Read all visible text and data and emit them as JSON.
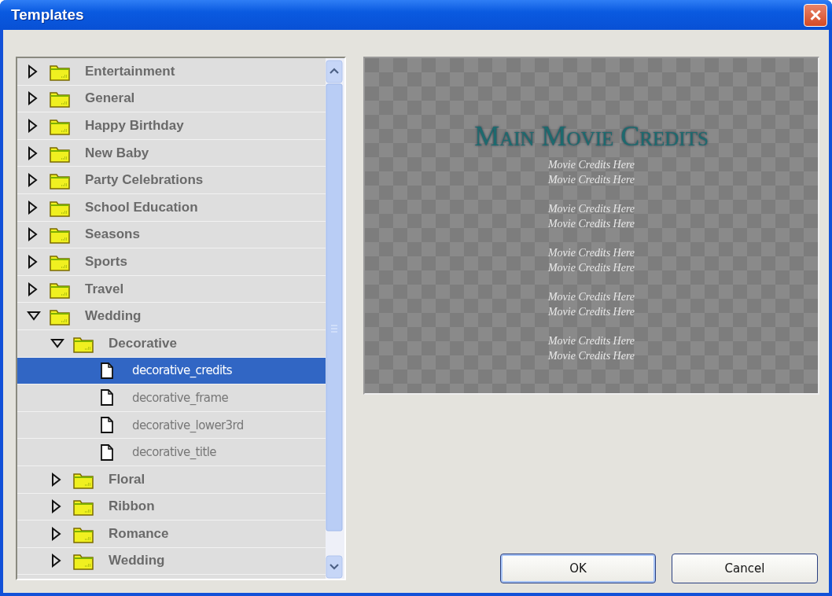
{
  "window": {
    "title": "Templates",
    "close": "×"
  },
  "tree": [
    {
      "kind": "folder",
      "label": "Entertainment",
      "expanded": false,
      "selected": false
    },
    {
      "kind": "folder",
      "label": "General",
      "expanded": false,
      "selected": false
    },
    {
      "kind": "folder",
      "label": "Happy Birthday",
      "expanded": false,
      "selected": false
    },
    {
      "kind": "folder",
      "label": "New Baby",
      "expanded": false,
      "selected": false
    },
    {
      "kind": "folder",
      "label": "Party Celebrations",
      "expanded": false,
      "selected": false
    },
    {
      "kind": "folder",
      "label": "School Education",
      "expanded": false,
      "selected": false
    },
    {
      "kind": "folder",
      "label": "Seasons",
      "expanded": false,
      "selected": false
    },
    {
      "kind": "folder",
      "label": "Sports",
      "expanded": false,
      "selected": false
    },
    {
      "kind": "folder",
      "label": "Travel",
      "expanded": false,
      "selected": false
    },
    {
      "kind": "folder",
      "label": "Wedding",
      "expanded": true,
      "selected": false,
      "children": [
        {
          "kind": "folder",
          "label": "Decorative",
          "expanded": true,
          "selected": false,
          "children": [
            {
              "kind": "file",
              "label": "decorative_credits",
              "selected": true
            },
            {
              "kind": "file",
              "label": "decorative_frame",
              "selected": false
            },
            {
              "kind": "file",
              "label": "decorative_lower3rd",
              "selected": false
            },
            {
              "kind": "file",
              "label": "decorative_title",
              "selected": false
            }
          ]
        },
        {
          "kind": "folder",
          "label": "Floral",
          "expanded": false,
          "selected": false
        },
        {
          "kind": "folder",
          "label": "Ribbon",
          "expanded": false,
          "selected": false
        },
        {
          "kind": "folder",
          "label": "Romance",
          "expanded": false,
          "selected": false
        },
        {
          "kind": "folder",
          "label": "Wedding",
          "expanded": false,
          "selected": false
        }
      ]
    }
  ],
  "preview": {
    "title": "Main Movie Credits",
    "credits": [
      [
        "Movie Credits Here",
        "Movie Credits Here"
      ],
      [
        "Movie Credits Here",
        "Movie Credits Here"
      ],
      [
        "Movie Credits Here",
        "Movie Credits Here"
      ],
      [
        "Movie Credits Here",
        "Movie Credits Here"
      ],
      [
        "Movie Credits Here",
        "Movie Credits Here"
      ]
    ]
  },
  "buttons": [
    {
      "label": "OK",
      "default": true
    },
    {
      "label": "Cancel",
      "default": false
    }
  ]
}
